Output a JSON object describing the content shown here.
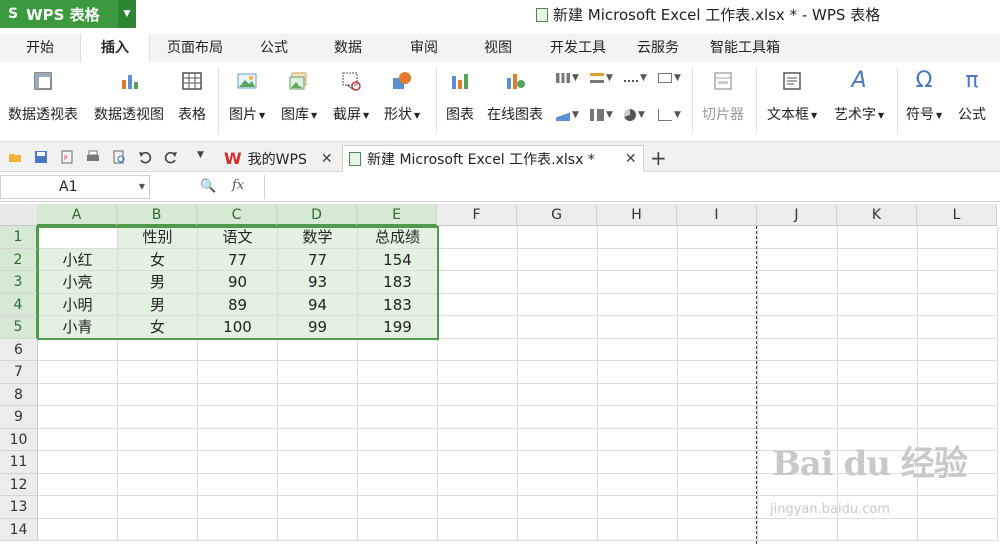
{
  "app": {
    "name": "WPS 表格",
    "logo": "S"
  },
  "window_title": "新建 Microsoft Excel 工作表.xlsx * - WPS 表格",
  "menu_tabs": [
    "开始",
    "插入",
    "页面布局",
    "公式",
    "数据",
    "审阅",
    "视图",
    "开发工具",
    "云服务",
    "智能工具箱"
  ],
  "active_menu": "插入",
  "ribbon": {
    "pivot_table": "数据透视表",
    "pivot_chart": "数据透视图",
    "table": "表格",
    "picture": "图片",
    "gallery": "图库",
    "screenshot": "截屏",
    "shapes": "形状",
    "chart": "图表",
    "online_chart": "在线图表",
    "slicer": "切片器",
    "textbox": "文本框",
    "wordart": "艺术字",
    "symbol": "符号",
    "equation": "公式",
    "symbol_glyph": "Ω",
    "equation_glyph": "π",
    "wordart_glyph": "A"
  },
  "doc_tabs": {
    "home": "我的WPS",
    "home_logo": "W",
    "file": "新建 Microsoft Excel 工作表.xlsx *"
  },
  "formula_bar": {
    "name_box": "A1",
    "fx": "fx",
    "value": ""
  },
  "sheet": {
    "columns": [
      "A",
      "B",
      "C",
      "D",
      "E",
      "F",
      "G",
      "H",
      "I",
      "J",
      "K",
      "L"
    ],
    "rows": [
      "1",
      "2",
      "3",
      "4",
      "5",
      "6",
      "7",
      "8",
      "9",
      "10",
      "11",
      "12",
      "13",
      "14"
    ],
    "cells": [
      [
        "",
        "性别",
        "语文",
        "数学",
        "总成绩"
      ],
      [
        "小红",
        "女",
        "77",
        "77",
        "154"
      ],
      [
        "小亮",
        "男",
        "90",
        "93",
        "183"
      ],
      [
        "小明",
        "男",
        "89",
        "94",
        "183"
      ],
      [
        "小青",
        "女",
        "100",
        "99",
        "199"
      ]
    ]
  },
  "watermark": {
    "main": "Bai du 经验",
    "sub": "jingyan.baidu.com"
  },
  "colors": {
    "accent": "#3c9a3e",
    "selection_fill": "#e3f1e0",
    "selection_border": "#4f9a4c"
  }
}
